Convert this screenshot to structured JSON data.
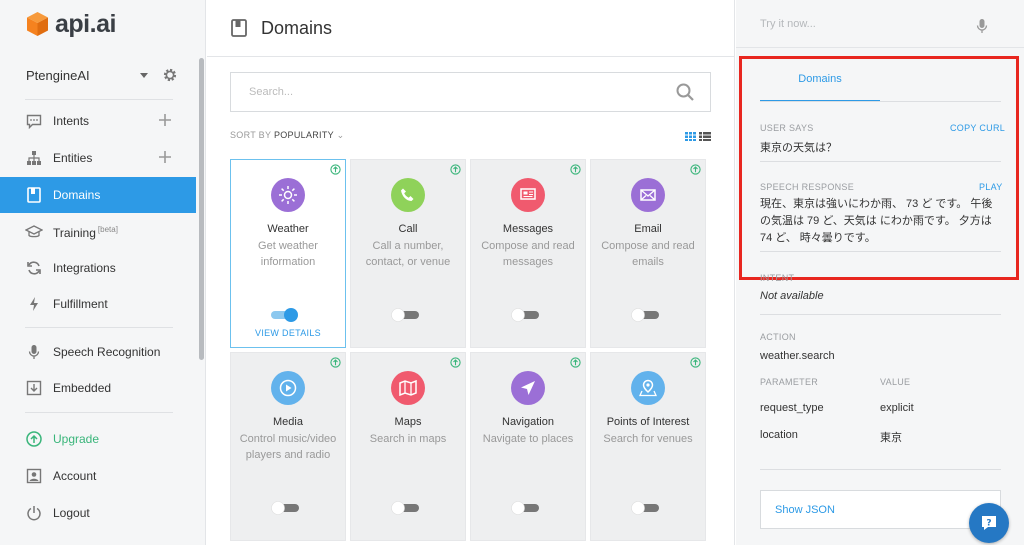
{
  "brand": {
    "name": "api.ai",
    "accent": "#2d9ae6",
    "logo_color": "#f5821f"
  },
  "agent": {
    "name": "PtengineAI"
  },
  "sidebar": {
    "items": [
      {
        "label": "Intents"
      },
      {
        "label": "Entities"
      },
      {
        "label": "Domains"
      },
      {
        "label": "Training",
        "badge": "[beta]"
      },
      {
        "label": "Integrations"
      },
      {
        "label": "Fulfillment"
      },
      {
        "label": "Speech Recognition"
      },
      {
        "label": "Embedded"
      },
      {
        "label": "Upgrade"
      },
      {
        "label": "Account"
      },
      {
        "label": "Logout"
      }
    ]
  },
  "header": {
    "title": "Domains"
  },
  "search": {
    "placeholder": "Search..."
  },
  "sort": {
    "prefix": "SORT BY",
    "value": "POPULARITY"
  },
  "domains": [
    {
      "title": "Weather",
      "description": "Get weather information",
      "enabled": true,
      "link": "VIEW DETAILS",
      "color": "#9b6fd6",
      "icon": "sun-icon"
    },
    {
      "title": "Call",
      "description": "Call a number, contact, or venue",
      "enabled": false,
      "color": "#8fd25a",
      "icon": "phone-icon"
    },
    {
      "title": "Messages",
      "description": "Compose and read messages",
      "enabled": false,
      "color": "#f05a6e",
      "icon": "message-icon"
    },
    {
      "title": "Email",
      "description": "Compose and read emails",
      "enabled": false,
      "color": "#9b6fd6",
      "icon": "envelope-icon"
    },
    {
      "title": "Media",
      "description": "Control music/video players and radio",
      "enabled": false,
      "color": "#62b2ec",
      "icon": "play-icon"
    },
    {
      "title": "Maps",
      "description": "Search in maps",
      "enabled": false,
      "color": "#f05a6e",
      "icon": "map-icon"
    },
    {
      "title": "Navigation",
      "description": "Navigate to places",
      "enabled": false,
      "color": "#9b6fd6",
      "icon": "navigation-arrow-icon"
    },
    {
      "title": "Points of Interest",
      "description": "Search for venues",
      "enabled": false,
      "color": "#62b2ec",
      "icon": "location-pin-icon"
    }
  ],
  "console": {
    "try_placeholder": "Try it now...",
    "tab": "Domains",
    "user_says_label": "USER SAYS",
    "copy_curl": "COPY CURL",
    "user_says": "東京の天気は？",
    "speech_label": "SPEECH RESPONSE",
    "play": "PLAY",
    "speech": "現在、東京は強いにわか雨、 73 ど です。 午後の気温は 79 ど、天気は にわか雨です。 夕方は 74 ど、 時々曇りです。",
    "intent_label": "INTENT",
    "intent": "Not available",
    "action_label": "ACTION",
    "action": "weather.search",
    "parameter_label": "PARAMETER",
    "value_label": "VALUE",
    "params": [
      {
        "name": "request_type",
        "value": "explicit"
      },
      {
        "name": "location",
        "value": "東京"
      }
    ],
    "show_json": "Show JSON"
  }
}
